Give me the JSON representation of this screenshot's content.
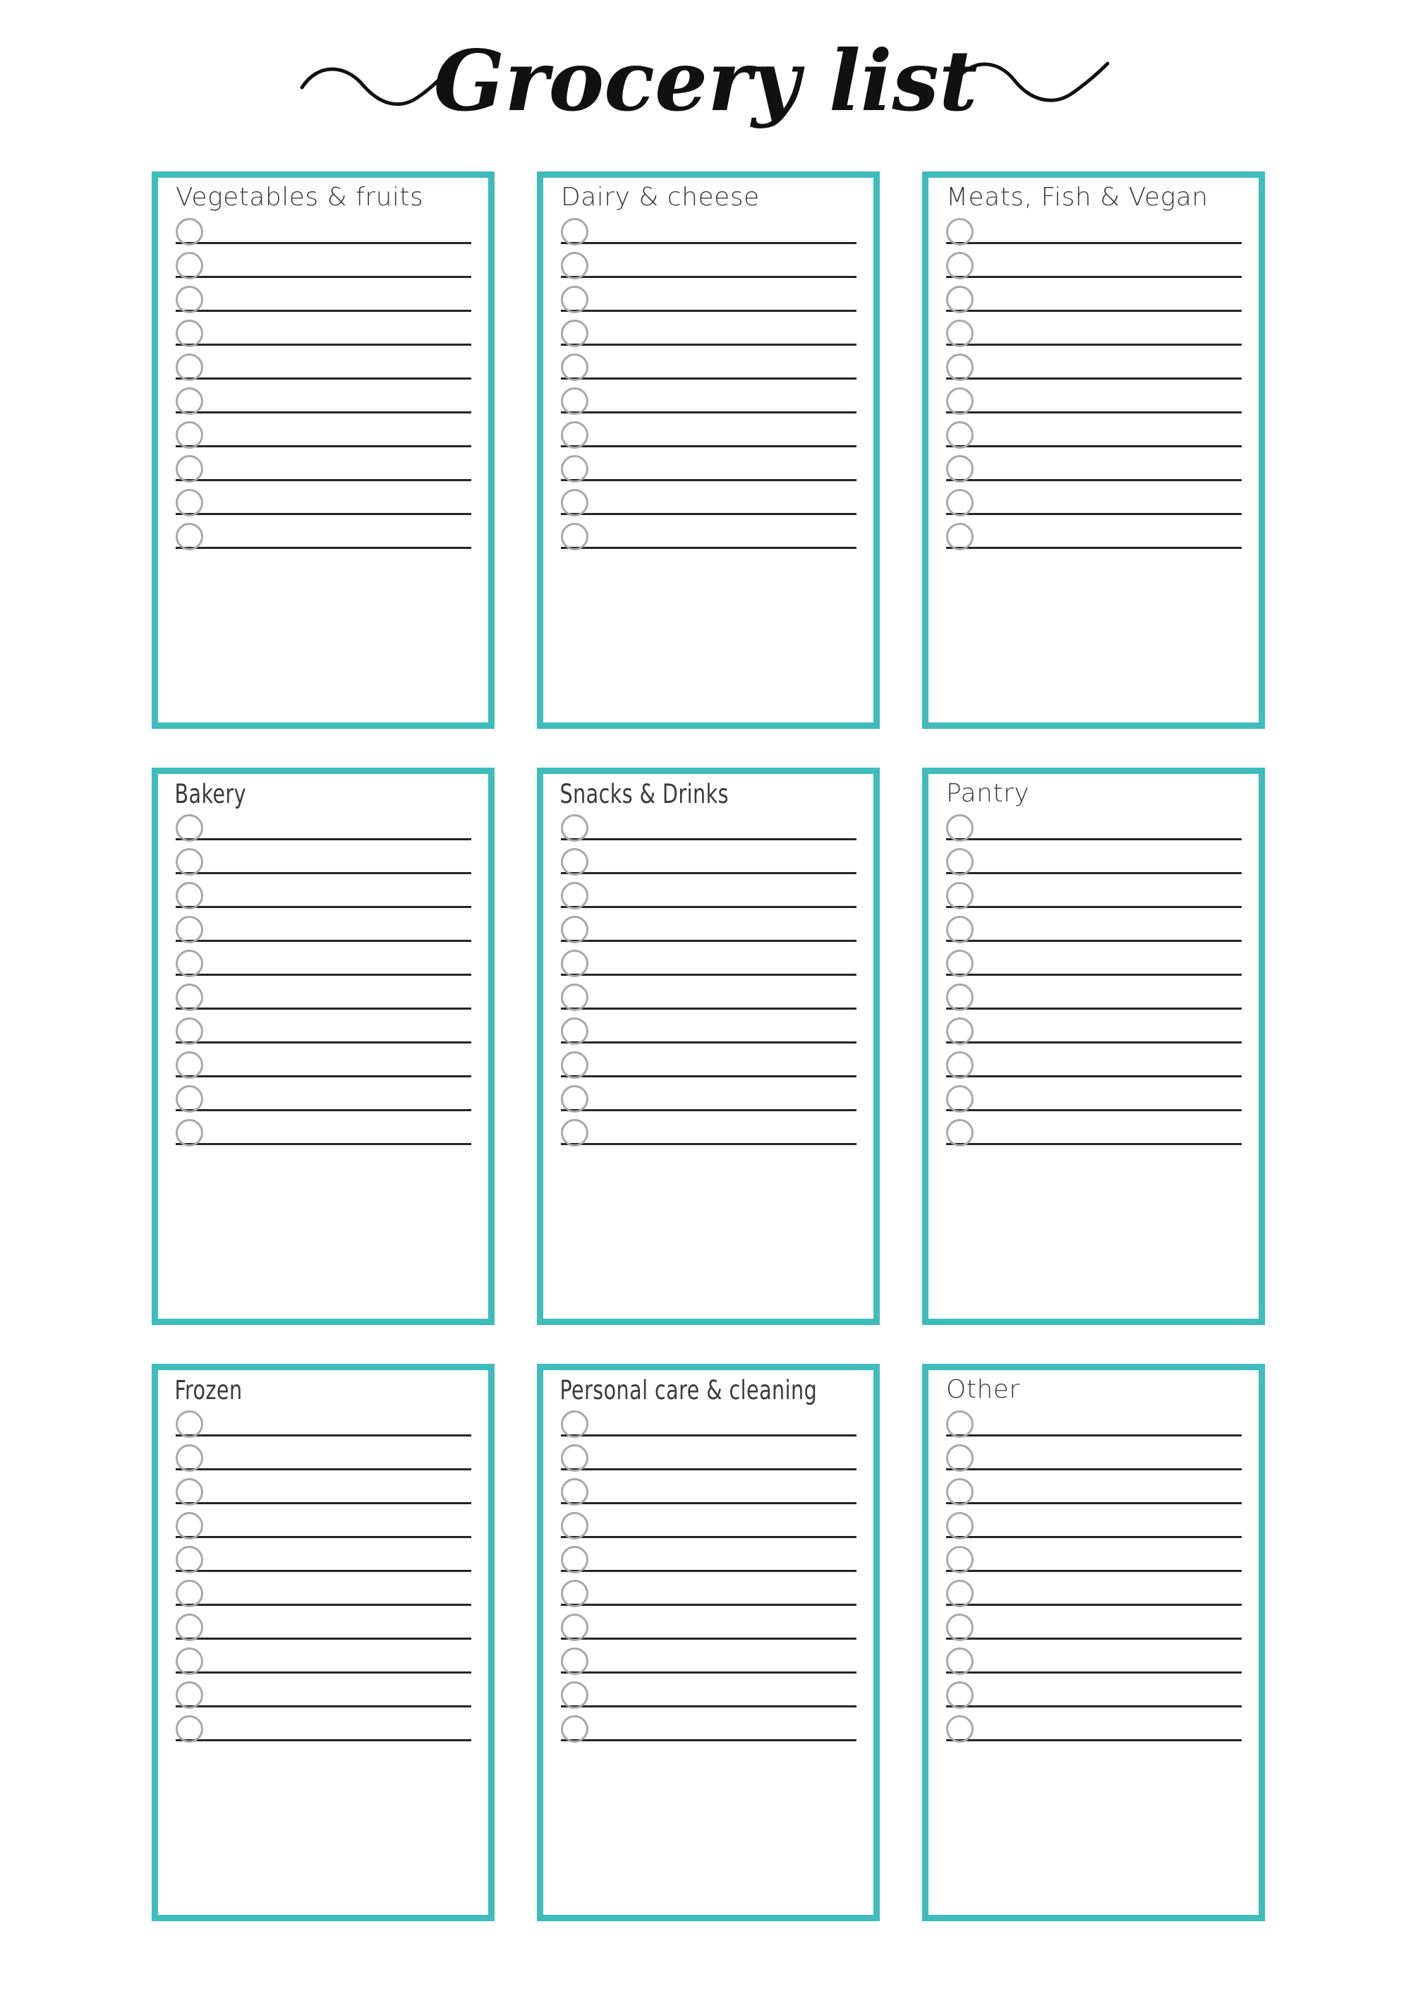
{
  "page": {
    "title": "Grocery list",
    "title_style": "brush-script",
    "left_swash": "~",
    "right_swash": "~",
    "accent_color": "#3fbcbc",
    "line_color": "#262626",
    "circle_color": "#a8a8a8",
    "background_color": "#ffffff",
    "rows_per_category": 10
  },
  "categories": [
    {
      "id": "vegetables-fruits",
      "label": "Vegetables & fruits",
      "style": "wide",
      "rows": 10
    },
    {
      "id": "dairy-cheese",
      "label": "Dairy & cheese",
      "style": "wide",
      "rows": 10
    },
    {
      "id": "meats-fish-vegan",
      "label": "Meats, Fish & Vegan",
      "style": "wide",
      "rows": 10
    },
    {
      "id": "bakery",
      "label": "Bakery",
      "style": "narrow",
      "rows": 10
    },
    {
      "id": "snacks-drinks",
      "label": "Snacks & Drinks",
      "style": "narrow",
      "rows": 10
    },
    {
      "id": "pantry",
      "label": "Pantry",
      "style": "wide",
      "rows": 10
    },
    {
      "id": "frozen",
      "label": "Frozen",
      "style": "narrow",
      "rows": 10
    },
    {
      "id": "personal-care-cleaning",
      "label": "Personal care & cleaning",
      "style": "narrow",
      "rows": 10
    },
    {
      "id": "other",
      "label": "Other",
      "style": "wide",
      "rows": 10
    }
  ]
}
